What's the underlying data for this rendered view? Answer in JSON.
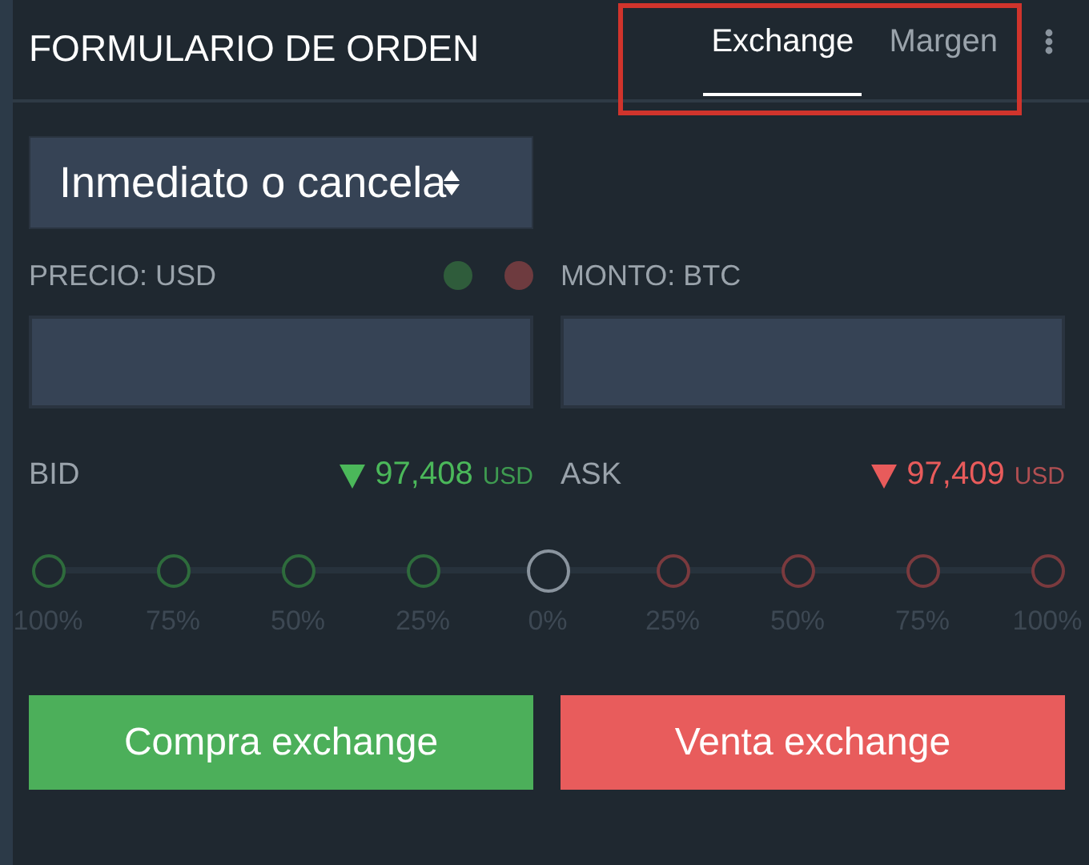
{
  "header": {
    "title": "FORMULARIO DE ORDEN",
    "tabs": [
      {
        "label": "Exchange",
        "selected": true
      },
      {
        "label": "Margen",
        "selected": false
      }
    ]
  },
  "order_type": {
    "value": "Inmediato o cancela"
  },
  "price": {
    "label": "PRECIO: USD"
  },
  "indicators": [
    {
      "color": "#2f5c3b"
    },
    {
      "color": "#6e3b3f"
    }
  ],
  "amount": {
    "label": "MONTO: BTC"
  },
  "quotes": [
    {
      "kind": "bid",
      "label": "BID",
      "value": "97,408",
      "unit": "USD"
    },
    {
      "kind": "ask",
      "label": "ASK",
      "value": "97,409",
      "unit": "USD"
    }
  ],
  "slider": {
    "steps": [
      {
        "label": "100%",
        "kind": "buy",
        "selected": false
      },
      {
        "label": "75%",
        "kind": "buy",
        "selected": false
      },
      {
        "label": "50%",
        "kind": "buy",
        "selected": false
      },
      {
        "label": "25%",
        "kind": "buy",
        "selected": false
      },
      {
        "label": "0%",
        "kind": "neutral",
        "selected": true
      },
      {
        "label": "25%",
        "kind": "sell",
        "selected": false
      },
      {
        "label": "50%",
        "kind": "sell",
        "selected": false
      },
      {
        "label": "75%",
        "kind": "sell",
        "selected": false
      },
      {
        "label": "100%",
        "kind": "sell",
        "selected": false
      }
    ]
  },
  "buttons": [
    {
      "kind": "buy",
      "label": "Compra exchange"
    },
    {
      "kind": "sell",
      "label": "Venta exchange"
    }
  ]
}
